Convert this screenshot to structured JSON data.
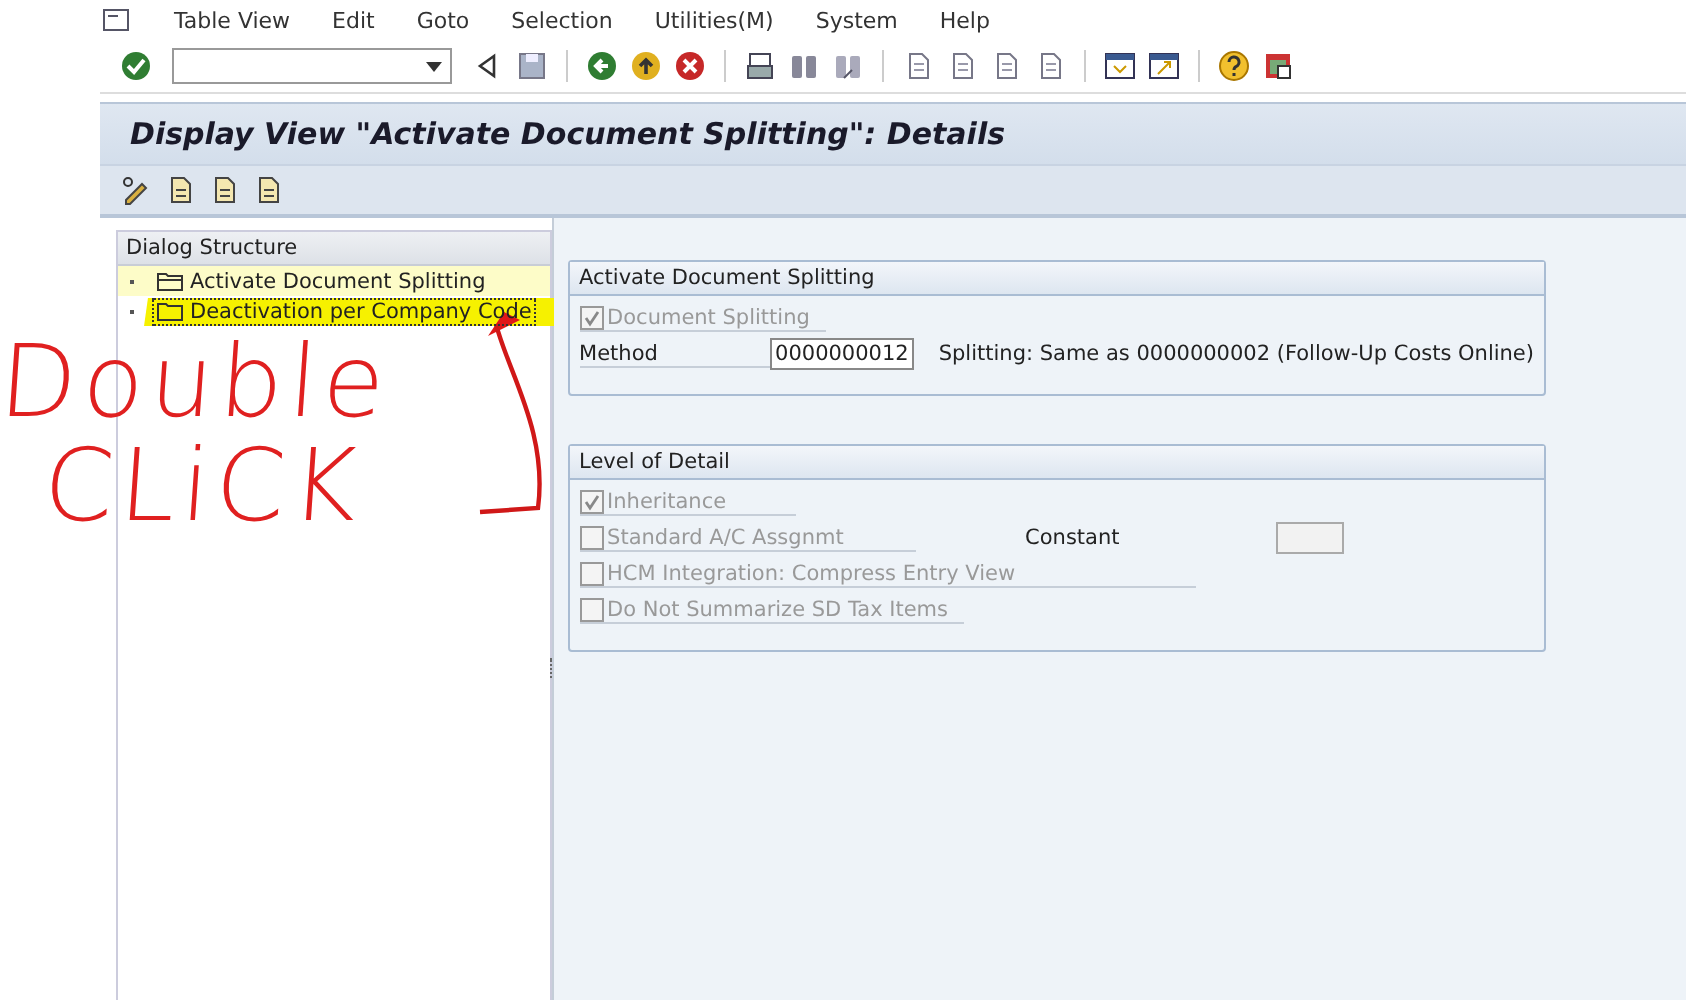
{
  "menu": [
    "Table View",
    "Edit",
    "Goto",
    "Selection",
    "Utilities(M)",
    "System",
    "Help"
  ],
  "title": "Display View \"Activate Document Splitting\": Details",
  "dialog_structure": {
    "title": "Dialog Structure",
    "items": [
      {
        "label": "Activate Document Splitting",
        "selected": true,
        "focused": false,
        "marked": false
      },
      {
        "label": "Deactivation per Company Code",
        "selected": false,
        "focused": true,
        "marked": true
      }
    ]
  },
  "groups": [
    {
      "title": "Activate Document Splitting",
      "rows": [
        {
          "kind": "checkbox",
          "label": "Document Splitting",
          "checked": true,
          "disabled": true
        },
        {
          "kind": "field",
          "label": "Method",
          "value": "0000000012",
          "description": "Splitting: Same as 0000000002 (Follow-Up Costs Online)"
        }
      ]
    },
    {
      "title": "Level of Detail",
      "rows": [
        {
          "kind": "checkbox",
          "label": "Inheritance",
          "checked": true,
          "disabled": true
        },
        {
          "kind": "checkbox",
          "label": "Standard A/C Assgnmt",
          "checked": false,
          "disabled": true,
          "extra_label": "Constant"
        },
        {
          "kind": "checkbox",
          "label": "HCM Integration: Compress Entry View",
          "checked": false,
          "disabled": true
        },
        {
          "kind": "checkbox",
          "label": "Do Not Summarize SD Tax Items",
          "checked": false,
          "disabled": true
        }
      ]
    }
  ],
  "annotation": {
    "lines": [
      "Double",
      "CLiCK"
    ]
  }
}
